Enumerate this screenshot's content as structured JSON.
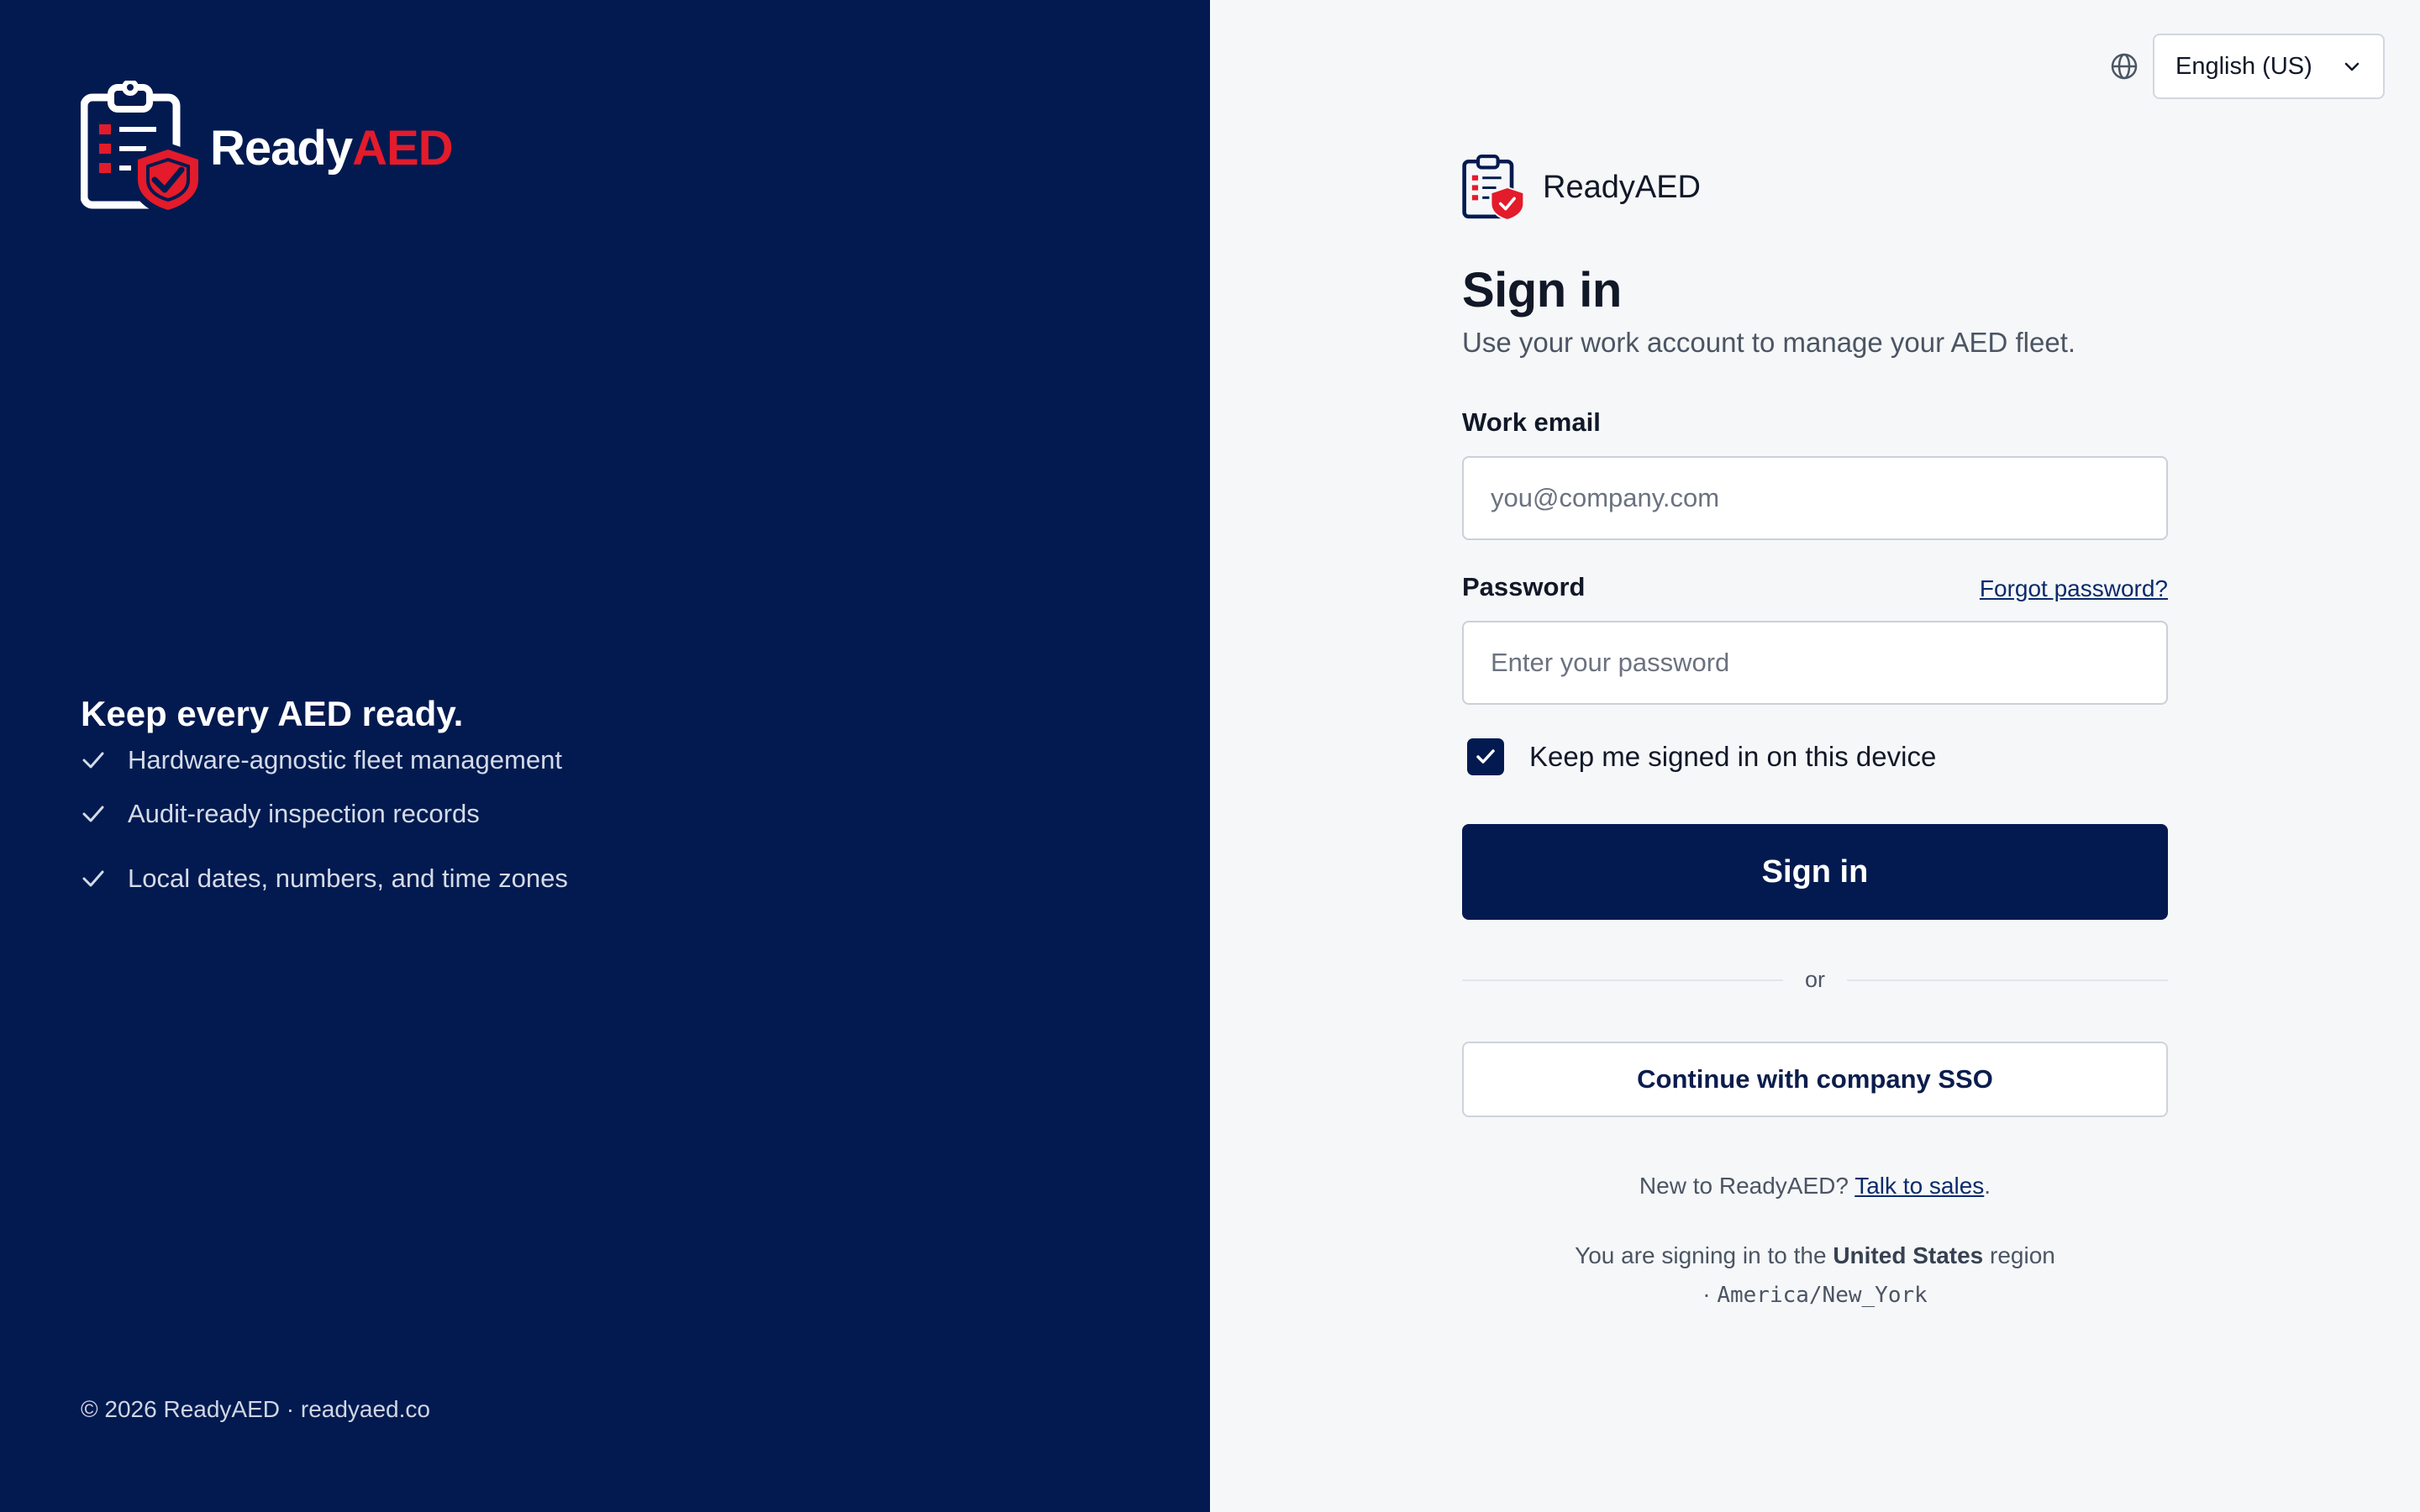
{
  "brand": {
    "word_part1": "Ready",
    "word_part2": "AED",
    "name": "ReadyAED",
    "colors": {
      "navy": "#021a50",
      "red": "#e31b2b"
    },
    "logo_icon": "clipboard-shield-check-icon"
  },
  "left_panel": {
    "headline": "Keep every AED ready.",
    "features": [
      {
        "icon": "check-icon",
        "text": "Hardware-agnostic fleet management"
      },
      {
        "icon": "check-icon",
        "text": "Audit-ready inspection records"
      },
      {
        "icon": "check-icon",
        "text": "Local dates, numbers, and time zones"
      }
    ],
    "footer": "© 2026 ReadyAED · readyaed.co"
  },
  "language": {
    "icon": "globe-icon",
    "selected": "English (US)"
  },
  "form": {
    "title": "Sign in",
    "subtitle": "Use your work account to manage your AED fleet.",
    "email_label": "Work email",
    "email_value": "",
    "email_placeholder": "you@company.com",
    "password_label": "Password",
    "forgot_link": "Forgot password?",
    "password_value": "",
    "password_placeholder": "Enter your password",
    "remember_label": "Keep me signed in on this device",
    "remember_checked": true,
    "submit_label": "Sign in",
    "divider_text": "or",
    "sso_label": "Continue with company SSO",
    "new_prefix": "New to ReadyAED?",
    "new_link": "Talk to sales",
    "new_suffix": ".",
    "region_prefix": "You are signing in to the",
    "region_name": "United States",
    "region_suffix": "region",
    "region_sep": "·",
    "timezone": "America/New_York"
  }
}
